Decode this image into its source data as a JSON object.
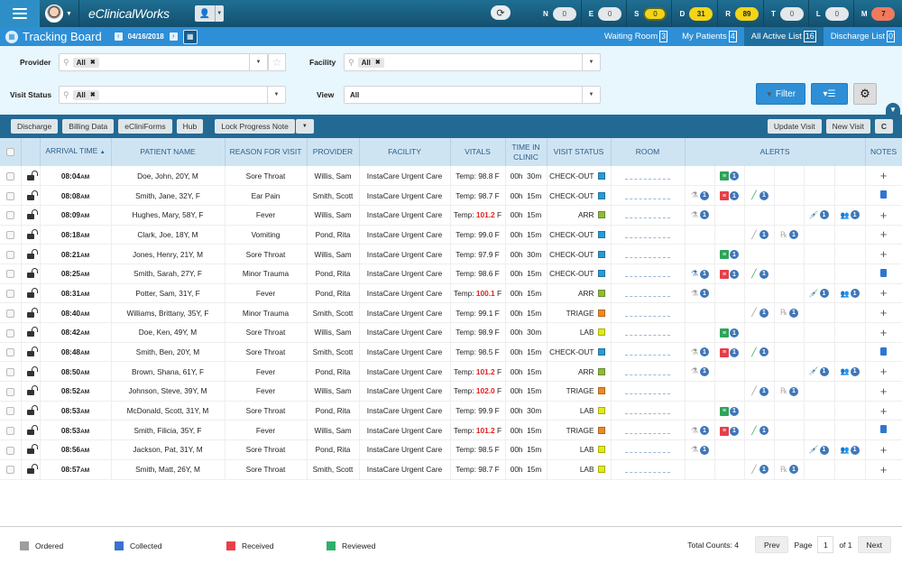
{
  "app": {
    "brand": "eClinicalWorks",
    "page_title": "Tracking Board",
    "date": "04/16/2018"
  },
  "counters": [
    {
      "label": "N",
      "value": "0",
      "style": "grey"
    },
    {
      "label": "E",
      "value": "0",
      "style": "grey"
    },
    {
      "label": "S",
      "value": "0",
      "style": "yellow-selected"
    },
    {
      "label": "D",
      "value": "31",
      "style": "yellow"
    },
    {
      "label": "R",
      "value": "89",
      "style": "yellow"
    },
    {
      "label": "T",
      "value": "0",
      "style": "grey"
    },
    {
      "label": "L",
      "value": "0",
      "style": "grey"
    },
    {
      "label": "M",
      "value": "7",
      "style": "red"
    }
  ],
  "tabs": [
    {
      "label": "Waiting Room",
      "count": "3",
      "active": false
    },
    {
      "label": "My Patients",
      "count": "4",
      "active": false
    },
    {
      "label": "All Active List",
      "count": "16",
      "active": true
    },
    {
      "label": "Discharge List",
      "count": "0",
      "active": false
    }
  ],
  "filters": {
    "provider_label": "Provider",
    "provider_value": "All",
    "facility_label": "Facility",
    "facility_value": "All",
    "visit_status_label": "Visit Status",
    "visit_status_value": "All",
    "view_label": "View",
    "view_value": "All",
    "filter_button": "Filter"
  },
  "actions": {
    "discharge": "Discharge",
    "billing": "Billing Data",
    "ecliniforms": "eCliniForms",
    "hub": "Hub",
    "lock_progress_note": "Lock Progress Note",
    "update_visit": "Update Visit",
    "new_visit": "New Visit"
  },
  "columns": [
    "",
    "",
    "ARRIVAL TIME",
    "PATIENT NAME",
    "REASON FOR VISIT",
    "PROVIDER",
    "FACILITY",
    "VITALS",
    "TIME IN CLINIC",
    "VISIT STATUS",
    "ROOM",
    "ALERTS",
    "NOTES"
  ],
  "status_colors": {
    "CHECK-OUT": "#2a9ad6",
    "ARR": "#8dbb3c",
    "TRIAGE": "#ec8a22",
    "LAB": "#e0ea18"
  },
  "rows": [
    {
      "time": "08:04",
      "ap": "AM",
      "name": "Doe, John, 20Y, M",
      "reason": "Sore Throat",
      "provider": "Willis, Sam",
      "facility": "InstaCare Urgent Care",
      "temp": "98.8",
      "high": false,
      "clinic": "00h  30m",
      "status": "CHECK-OUT",
      "alerts": [
        "",
        "doc-g",
        "",
        "",
        "",
        ""
      ],
      "note": "plus"
    },
    {
      "time": "08:08",
      "ap": "AM",
      "name": "Smith, Jane, 32Y, F",
      "reason": "Ear Pain",
      "provider": "Smith, Scott",
      "facility": "InstaCare Urgent Care",
      "temp": "98.7",
      "high": false,
      "clinic": "00h  15m",
      "status": "CHECK-OUT",
      "alerts": [
        "lab",
        "doc-r",
        "line-g",
        "",
        "",
        ""
      ],
      "note": "doc"
    },
    {
      "time": "08:09",
      "ap": "AM",
      "name": "Hughes, Mary, 58Y, F",
      "reason": "Fever",
      "provider": "Willis, Sam",
      "facility": "InstaCare Urgent Care",
      "temp": "101.2",
      "high": true,
      "clinic": "00h  15m",
      "status": "ARR",
      "alerts": [
        "lab",
        "",
        "",
        "",
        "syr",
        "ref"
      ],
      "note": "plus"
    },
    {
      "time": "08:18",
      "ap": "AM",
      "name": "Clark, Joe, 18Y, M",
      "reason": "Vomiting",
      "provider": "Pond, Rita",
      "facility": "InstaCare Urgent Care",
      "temp": "99.0",
      "high": false,
      "clinic": "00h  15m",
      "status": "CHECK-OUT",
      "alerts": [
        "",
        "",
        "line-gr",
        "rx",
        "",
        ""
      ],
      "note": "plus"
    },
    {
      "time": "08:21",
      "ap": "AM",
      "name": "Jones, Henry, 21Y, M",
      "reason": "Sore Throat",
      "provider": "Willis, Sam",
      "facility": "InstaCare Urgent Care",
      "temp": "97.9",
      "high": false,
      "clinic": "00h  30m",
      "status": "CHECK-OUT",
      "alerts": [
        "",
        "doc-g",
        "",
        "",
        "",
        ""
      ],
      "note": "plus"
    },
    {
      "time": "08:25",
      "ap": "AM",
      "name": "Smith, Sarah, 27Y, F",
      "reason": "Minor Trauma",
      "provider": "Pond, Rita",
      "facility": "InstaCare Urgent Care",
      "temp": "98.6",
      "high": false,
      "clinic": "00h  15m",
      "status": "CHECK-OUT",
      "alerts": [
        "lab-b",
        "doc-r",
        "line-g",
        "",
        "",
        ""
      ],
      "note": "doc"
    },
    {
      "time": "08:31",
      "ap": "AM",
      "name": "Potter, Sam, 31Y, F",
      "reason": "Fever",
      "provider": "Pond, Rita",
      "facility": "InstaCare Urgent Care",
      "temp": "100.1",
      "high": true,
      "clinic": "00h  15m",
      "status": "ARR",
      "alerts": [
        "lab",
        "",
        "",
        "",
        "syr",
        "ref"
      ],
      "note": "plus"
    },
    {
      "time": "08:40",
      "ap": "AM",
      "name": "Williams, Brittany, 35Y, F",
      "reason": "Minor Trauma",
      "provider": "Smith, Scott",
      "facility": "InstaCare Urgent Care",
      "temp": "99.1",
      "high": false,
      "clinic": "00h  15m",
      "status": "TRIAGE",
      "alerts": [
        "",
        "",
        "line-gr",
        "rx",
        "",
        ""
      ],
      "note": "plus"
    },
    {
      "time": "08:42",
      "ap": "AM",
      "name": "Doe, Ken, 49Y, M",
      "reason": "Sore Throat",
      "provider": "Willis, Sam",
      "facility": "InstaCare Urgent Care",
      "temp": "98.9",
      "high": false,
      "clinic": "00h  30m",
      "status": "LAB",
      "alerts": [
        "",
        "doc-g",
        "",
        "",
        "",
        ""
      ],
      "note": "plus"
    },
    {
      "time": "08:48",
      "ap": "AM",
      "name": "Smith, Ben, 20Y, M",
      "reason": "Sore Throat",
      "provider": "Smith, Scott",
      "facility": "InstaCare Urgent Care",
      "temp": "98.5",
      "high": false,
      "clinic": "00h  15m",
      "status": "CHECK-OUT",
      "alerts": [
        "lab",
        "doc-r",
        "line-g",
        "",
        "",
        ""
      ],
      "note": "doc"
    },
    {
      "time": "08:50",
      "ap": "AM",
      "name": "Brown, Shana, 61Y, F",
      "reason": "Fever",
      "provider": "Pond, Rita",
      "facility": "InstaCare Urgent Care",
      "temp": "101.2",
      "high": true,
      "clinic": "00h  15m",
      "status": "ARR",
      "alerts": [
        "lab",
        "",
        "",
        "",
        "syr",
        "ref"
      ],
      "note": "plus"
    },
    {
      "time": "08:52",
      "ap": "AM",
      "name": "Johnson, Steve, 39Y, M",
      "reason": "Fever",
      "provider": "Willis, Sam",
      "facility": "InstaCare Urgent Care",
      "temp": "102.0",
      "high": true,
      "clinic": "00h  15m",
      "status": "TRIAGE",
      "alerts": [
        "",
        "",
        "line-gr",
        "rx",
        "",
        ""
      ],
      "note": "plus"
    },
    {
      "time": "08:53",
      "ap": "AM",
      "name": "McDonald, Scott, 31Y, M",
      "reason": "Sore Throat",
      "provider": "Pond, Rita",
      "facility": "InstaCare Urgent Care",
      "temp": "99.9",
      "high": false,
      "clinic": "00h  30m",
      "status": "LAB",
      "alerts": [
        "",
        "doc-g",
        "",
        "",
        "",
        ""
      ],
      "note": "plus"
    },
    {
      "time": "08:53",
      "ap": "AM",
      "name": "Smith, Filicia, 35Y, F",
      "reason": "Fever",
      "provider": "Willis, Sam",
      "facility": "InstaCare Urgent Care",
      "temp": "101.2",
      "high": true,
      "clinic": "00h  15m",
      "status": "TRIAGE",
      "alerts": [
        "lab",
        "doc-r",
        "line-g",
        "",
        "",
        ""
      ],
      "note": "doc"
    },
    {
      "time": "08:56",
      "ap": "AM",
      "name": "Jackson, Pat, 31Y, M",
      "reason": "Sore Throat",
      "provider": "Pond, Rita",
      "facility": "InstaCare Urgent Care",
      "temp": "98.5",
      "high": false,
      "clinic": "00h  15m",
      "status": "LAB",
      "alerts": [
        "lab",
        "",
        "",
        "",
        "syr",
        "ref"
      ],
      "note": "plus"
    },
    {
      "time": "08:57",
      "ap": "AM",
      "name": "Smith, Matt, 26Y, M",
      "reason": "Sore Throat",
      "provider": "Smith, Scott",
      "facility": "InstaCare Urgent Care",
      "temp": "98.7",
      "high": false,
      "clinic": "00h  15m",
      "status": "LAB",
      "alerts": [
        "",
        "",
        "line-gr",
        "rx",
        "",
        ""
      ],
      "note": "plus"
    }
  ],
  "alert_badge_value": "1",
  "legend": [
    {
      "label": "Ordered",
      "color": "#9e9e9e"
    },
    {
      "label": "Collected",
      "color": "#3a72d0"
    },
    {
      "label": "Received",
      "color": "#e8404a"
    },
    {
      "label": "Reviewed",
      "color": "#2fb06a"
    }
  ],
  "pager": {
    "total_label": "Total Counts: 4",
    "prev": "Prev",
    "page_label": "Page",
    "page": "1",
    "of_label": "of 1",
    "next": "Next"
  }
}
